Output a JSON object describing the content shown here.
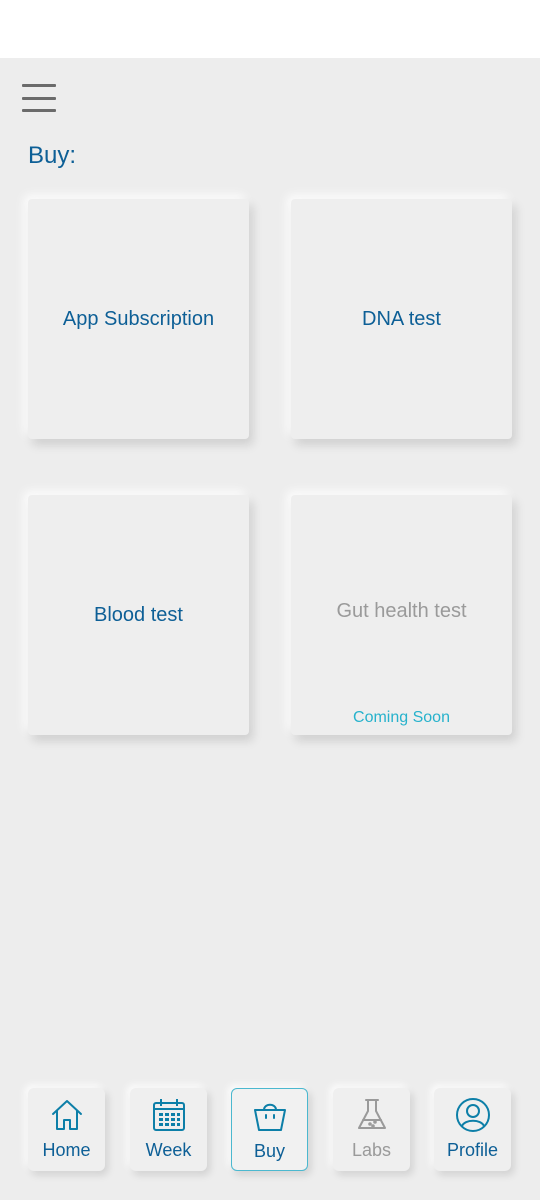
{
  "header": {
    "menu_icon": "hamburger-menu-icon",
    "title": "Buy:"
  },
  "products": [
    {
      "label": "App Subscription",
      "enabled": true
    },
    {
      "label": "DNA test",
      "enabled": true
    },
    {
      "label": "Blood test",
      "enabled": true
    },
    {
      "label": "Gut health test",
      "enabled": false,
      "note": "Coming Soon"
    }
  ],
  "bottom_nav": [
    {
      "label": "Home",
      "icon": "home-icon",
      "active": false
    },
    {
      "label": "Week",
      "icon": "calendar-icon",
      "active": false
    },
    {
      "label": "Buy",
      "icon": "shopping-bag-icon",
      "active": true
    },
    {
      "label": "Labs",
      "icon": "flask-icon",
      "active": false
    },
    {
      "label": "Profile",
      "icon": "profile-icon",
      "active": false
    }
  ],
  "colors": {
    "primary": "#0d5f96",
    "accent": "#27b2cc",
    "muted": "#9a9a9a",
    "background": "#ededed"
  }
}
